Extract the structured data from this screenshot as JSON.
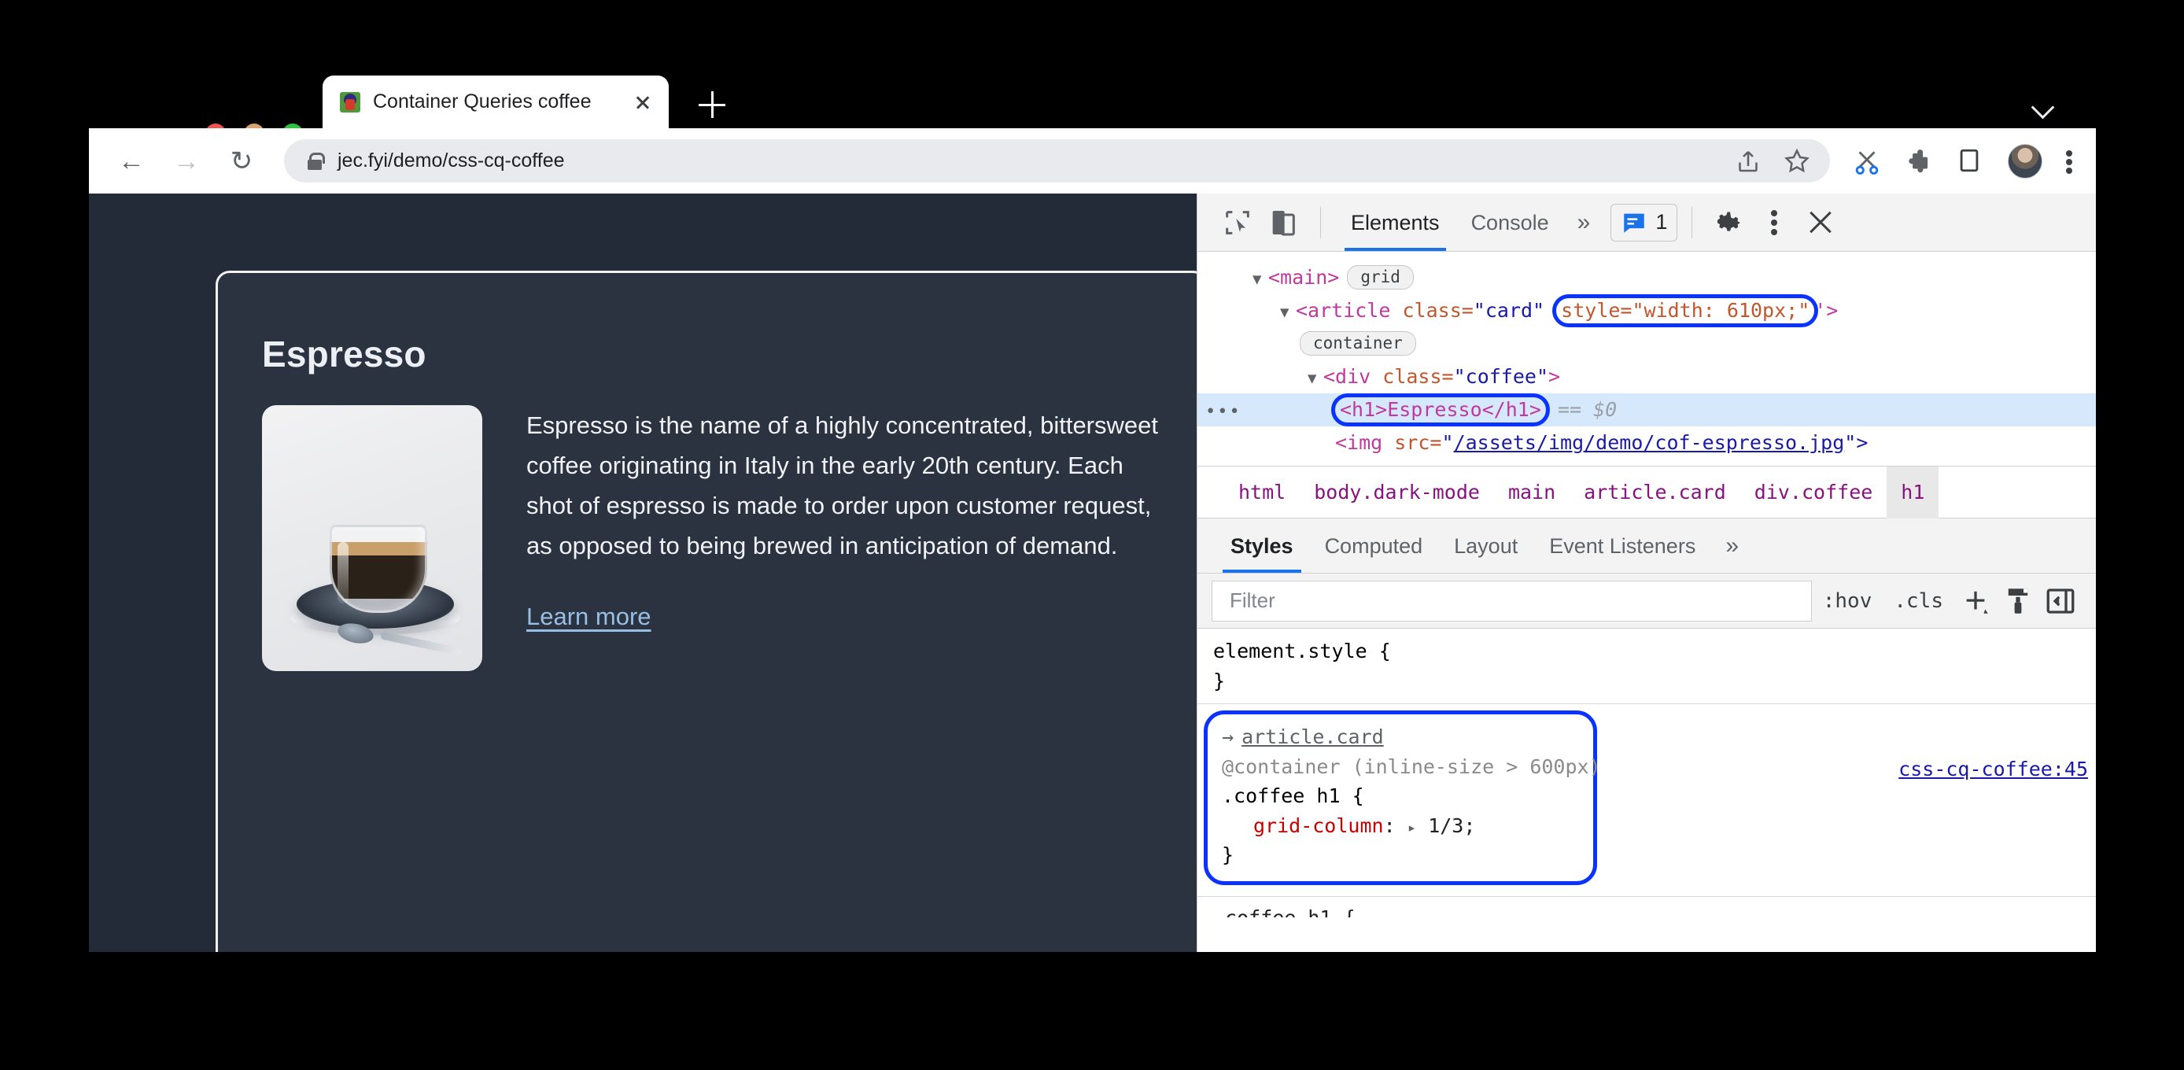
{
  "browser": {
    "traffic_lights": [
      {
        "name": "close",
        "color": "#f0564f"
      },
      {
        "name": "minimize",
        "color": "#d8a371"
      },
      {
        "name": "maximize",
        "color": "#2bc43e"
      }
    ],
    "tab": {
      "title": "Container Queries coffee",
      "favicon": "penguin-favicon",
      "close_label": "×"
    },
    "new_tab_label": "+",
    "window_collapse_icon": "chevron-down-icon",
    "toolbar": {
      "back_glyph": "←",
      "forward_glyph": "→",
      "reload_glyph": "↻",
      "url": "jec.fyi/demo/css-cq-coffee",
      "lock_icon": "lock-icon",
      "share_glyph": "⇧",
      "bookmark_glyph": "☆",
      "scissors_glyph": "✂",
      "extensions_glyph": "❖",
      "sidepanel_glyph": "▯",
      "profile_name": "avatar",
      "menu_glyph": "⋮"
    }
  },
  "page": {
    "card": {
      "title": "Espresso",
      "image_alt": "espresso-cup-photo",
      "description": "Espresso is the name of a highly concentrated, bittersweet coffee originating in Italy in the early 20th century. Each shot of espresso is made to order upon customer request, as opposed to being brewed in anticipation of demand.",
      "link_label": "Learn more",
      "resize_handle": "resize-grabber"
    }
  },
  "devtools": {
    "toolbar": {
      "inspect_icon": "inspect-element-icon",
      "device_icon": "device-toolbar-icon",
      "tabs": [
        {
          "label": "Elements",
          "active": true
        },
        {
          "label": "Console",
          "active": false
        }
      ],
      "more_tabs_glyph": "»",
      "issues_icon": "issues-message-icon",
      "issues_count": "1",
      "settings_icon": "gear-icon",
      "menu_glyph": "⋮",
      "close_glyph": "×"
    },
    "dom": {
      "rows": [
        {
          "indent": 0,
          "triangle": "▼",
          "tag_open": "<main>",
          "badge": "grid"
        },
        {
          "indent": 1,
          "triangle": "▼",
          "tag": "<article",
          "attr_name": "class=",
          "attr_value": "\"card\"",
          "highlight_attr": "style=\"width: 610px;\"",
          "tag_close": "'>",
          "badge": "container"
        },
        {
          "indent": 2,
          "triangle": "▼",
          "tag": "<div",
          "attr_name": "class=",
          "attr_value": "\"coffee\"",
          "tag_close": ">"
        },
        {
          "indent": 3,
          "selected": true,
          "dots": "•••",
          "highlight_node": "<h1>Espresso</h1>",
          "suffix_eq": "==",
          "suffix_var": "$0"
        },
        {
          "indent": 3,
          "tag": "<img",
          "attr_name": "src=",
          "attr_value_link": "/assets/img/demo/cof-espresso.jpg",
          "tag_close": "\">"
        }
      ]
    },
    "breadcrumb": [
      {
        "label": "html",
        "active": false
      },
      {
        "label": "body.dark-mode",
        "active": false
      },
      {
        "label": "main",
        "active": false
      },
      {
        "label": "article.card",
        "active": false
      },
      {
        "label": "div.coffee",
        "active": false
      },
      {
        "label": "h1",
        "active": true
      }
    ],
    "styles_tabs": [
      {
        "label": "Styles",
        "active": true
      },
      {
        "label": "Computed",
        "active": false
      },
      {
        "label": "Layout",
        "active": false
      },
      {
        "label": "Event Listeners",
        "active": false
      }
    ],
    "styles_more_glyph": "»",
    "filter": {
      "placeholder": "Filter",
      "value": "",
      "hov_label": ":hov",
      "cls_label": ".cls",
      "new_rule_glyph": "+",
      "style_icon": "paintbrush-icon",
      "sidebar_icon": "toggle-sidebar-icon"
    },
    "rules": {
      "element_style": {
        "selector": "element.style {",
        "close": "}"
      },
      "container_rule": {
        "inherit_arrow": "→",
        "inherit_selector": "article.card",
        "at_rule": "@container (inline-size > 600px)",
        "selector": ".coffee h1 {",
        "prop_name": "grid-column",
        "prop_expand_glyph": "▸",
        "prop_value": "1/3;",
        "close": "}",
        "origin": "css-cq-coffee:45"
      }
    }
  },
  "colors": {
    "devtools_accent": "#1a73e8",
    "annotation_ring": "#0a33ff",
    "page_bg": "#242b38",
    "card_bg": "#2b3240",
    "link": "#97bfe4"
  }
}
